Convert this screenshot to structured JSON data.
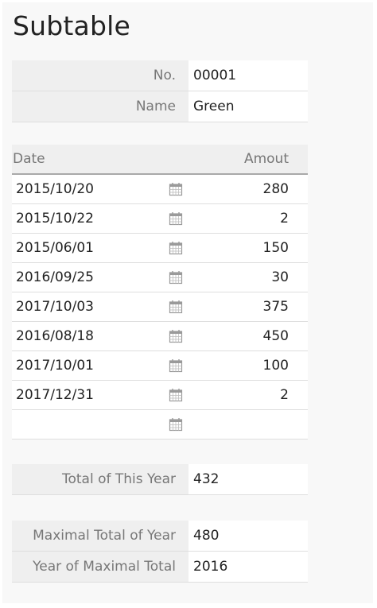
{
  "title": "Subtable",
  "record": {
    "no_label": "No.",
    "no_value": "00001",
    "name_label": "Name",
    "name_value": "Green"
  },
  "subtable": {
    "columns": {
      "date": "Date",
      "amount": "Amout"
    },
    "calendar_icon": "calendar-icon",
    "rows": [
      {
        "date": "2015/10/20",
        "amount": "280"
      },
      {
        "date": "2015/10/22",
        "amount": "2"
      },
      {
        "date": "2015/06/01",
        "amount": "150"
      },
      {
        "date": "2016/09/25",
        "amount": "30"
      },
      {
        "date": "2017/10/03",
        "amount": "375"
      },
      {
        "date": "2016/08/18",
        "amount": "450"
      },
      {
        "date": "2017/10/01",
        "amount": "100"
      },
      {
        "date": "2017/12/31",
        "amount": "2"
      },
      {
        "date": "",
        "amount": ""
      }
    ]
  },
  "totals": {
    "this_year_label": "Total of This Year",
    "this_year_value": "432",
    "max_total_label": "Maximal Total of Year",
    "max_total_value": "480",
    "max_year_label": "Year of Maximal Total",
    "max_year_value": "2016"
  }
}
